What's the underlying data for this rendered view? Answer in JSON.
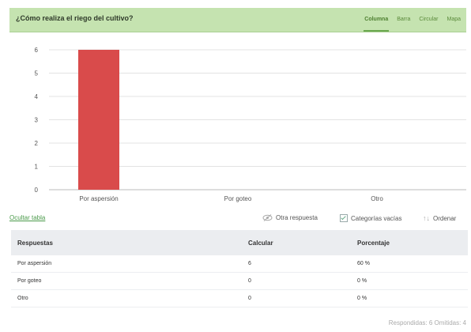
{
  "question": {
    "title": "¿Cómo realiza el riego del cultivo?"
  },
  "tabs": [
    {
      "label": "Columna",
      "active": true
    },
    {
      "label": "Barra",
      "active": false
    },
    {
      "label": "Circular",
      "active": false
    },
    {
      "label": "Mapa",
      "active": false
    }
  ],
  "chart_data": {
    "type": "bar",
    "categories": [
      "Por aspersión",
      "Por goteo",
      "Otro"
    ],
    "values": [
      6,
      0,
      0
    ],
    "y_ticks": [
      "0",
      "1",
      "2",
      "3",
      "4",
      "5",
      "6"
    ],
    "ylim": [
      0,
      6
    ],
    "grid": true,
    "bar_color": "#d94b4b"
  },
  "controls": {
    "hide_table": "Ocultar tabla",
    "other_response": "Otra respuesta",
    "empty_categories": "Categorías vacías",
    "sort": "Ordenar"
  },
  "table": {
    "headers": {
      "respuestas": "Respuestas",
      "calcular": "Calcular",
      "porcentaje": "Porcentaje"
    },
    "rows": [
      {
        "respuesta": "Por aspersión",
        "calcular": "6",
        "porcentaje": "60 %"
      },
      {
        "respuesta": "Por goteo",
        "calcular": "0",
        "porcentaje": "0 %"
      },
      {
        "respuesta": "Otro",
        "calcular": "0",
        "porcentaje": "0 %"
      }
    ]
  },
  "summary": {
    "text": "Respondidas: 6  Omitidas: 4"
  }
}
